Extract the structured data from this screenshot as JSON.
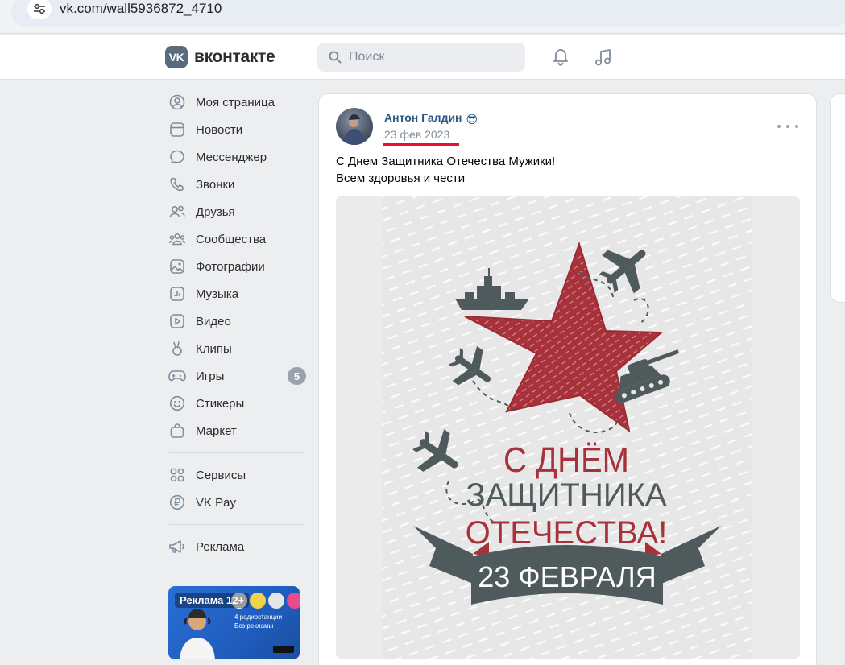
{
  "browser": {
    "url": "vk.com/wall5936872_4710"
  },
  "header": {
    "logo_mark": "VK",
    "logo_text": "вконтакте",
    "search_placeholder": "Поиск"
  },
  "sidebar": {
    "items": [
      {
        "label": "Моя страница",
        "icon": "user-circle-icon"
      },
      {
        "label": "Новости",
        "icon": "news-icon"
      },
      {
        "label": "Мессенджер",
        "icon": "message-icon"
      },
      {
        "label": "Звонки",
        "icon": "phone-icon"
      },
      {
        "label": "Друзья",
        "icon": "friends-icon"
      },
      {
        "label": "Сообщества",
        "icon": "communities-icon"
      },
      {
        "label": "Фотографии",
        "icon": "photo-icon"
      },
      {
        "label": "Музыка",
        "icon": "music-icon"
      },
      {
        "label": "Видео",
        "icon": "video-icon"
      },
      {
        "label": "Клипы",
        "icon": "clips-icon"
      },
      {
        "label": "Игры",
        "icon": "games-icon",
        "badge": "5"
      },
      {
        "label": "Стикеры",
        "icon": "smile-icon"
      },
      {
        "label": "Маркет",
        "icon": "bag-icon"
      }
    ],
    "items2": [
      {
        "label": "Сервисы",
        "icon": "services-icon"
      },
      {
        "label": "VK Pay",
        "icon": "vkpay-icon"
      }
    ],
    "items3": [
      {
        "label": "Реклама",
        "icon": "megaphone-icon"
      }
    ],
    "ad": {
      "label": "Реклама 12+",
      "line1": "4 радиостанции",
      "line2": "Без рекламы"
    }
  },
  "post": {
    "author": "Антон Галдин",
    "author_emoji": "😎",
    "date": "23 фев 2023",
    "text_line1": "С Днем Защитника Отечества Мужики!",
    "text_line2": "Всем здоровья и чести",
    "image": {
      "line1": "С ДНЁМ",
      "line2": "ЗАЩИТНИКА",
      "line3": "ОТЕЧЕСТВА!",
      "ribbon": "23 ФЕВРАЛЯ"
    }
  },
  "colors": {
    "link": "#2a5885",
    "accent_red": "#a8323b",
    "dark_slate": "#4f5a5c",
    "date_underline": "#e8112d"
  }
}
